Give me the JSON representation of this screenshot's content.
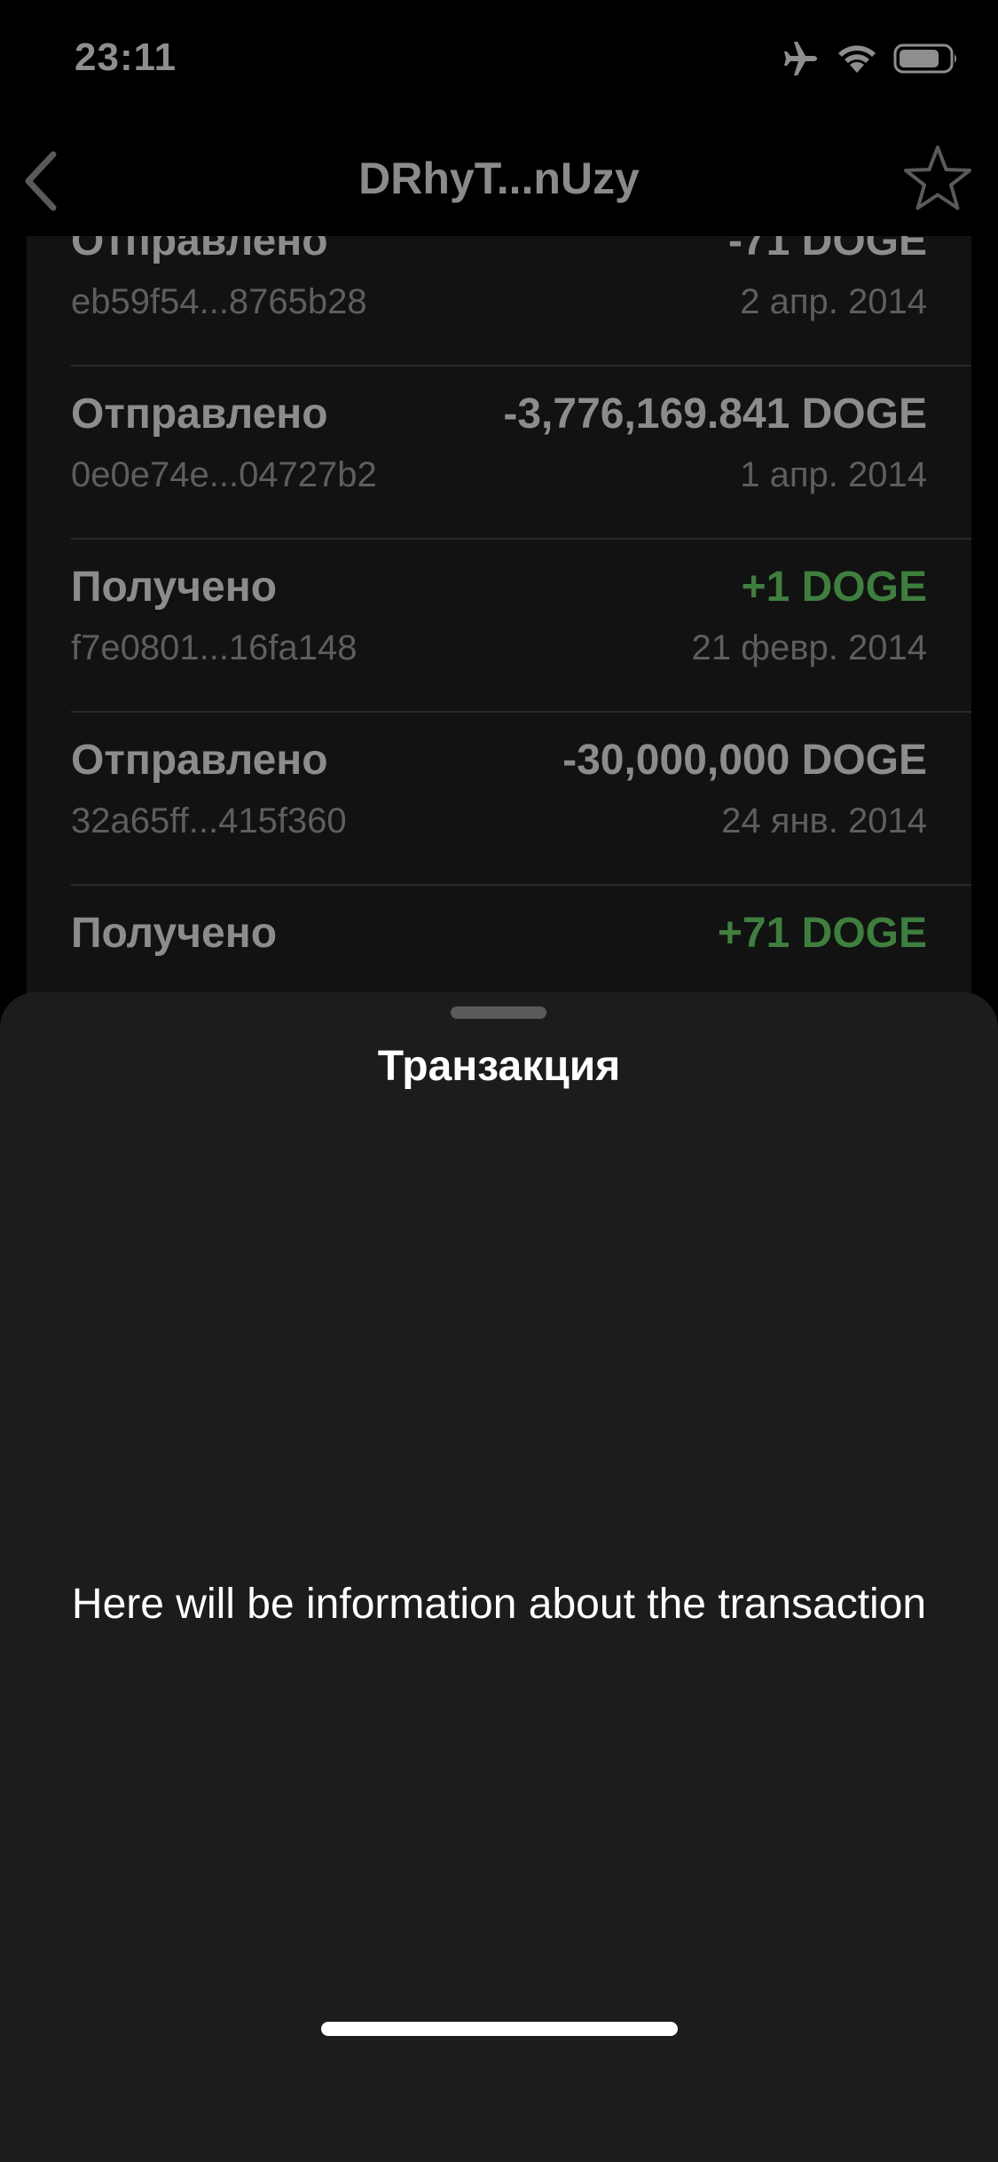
{
  "status_bar": {
    "time": "23:11",
    "icons": [
      "airplane-icon",
      "wifi-icon",
      "battery-icon"
    ]
  },
  "nav": {
    "title": "DRhyT...nUzy",
    "back_icon": "chevron-left-icon",
    "favorite_icon": "star-icon"
  },
  "transactions": [
    {
      "type": "Отправлено",
      "amount": "-71 DOGE",
      "hash": "eb59f54...8765b28",
      "date": "2 апр. 2014",
      "positive": false
    },
    {
      "type": "Отправлено",
      "amount": "-3,776,169.841 DOGE",
      "hash": "0e0e74e...04727b2",
      "date": "1 апр. 2014",
      "positive": false
    },
    {
      "type": "Получено",
      "amount": "+1 DOGE",
      "hash": "f7e0801...16fa148",
      "date": "21 февр. 2014",
      "positive": true
    },
    {
      "type": "Отправлено",
      "amount": "-30,000,000 DOGE",
      "hash": "32a65ff...415f360",
      "date": "24 янв. 2014",
      "positive": false
    },
    {
      "type": "Получено",
      "amount": "+71 DOGE",
      "hash": "",
      "date": "",
      "positive": true
    }
  ],
  "sheet": {
    "title": "Транзакция",
    "body": "Here will be information about the transaction"
  },
  "colors": {
    "background": "#000000",
    "sheet": "#1c1c1c",
    "positive_amount": "#3e7f3e",
    "dim_text": "#8c8c8c"
  }
}
